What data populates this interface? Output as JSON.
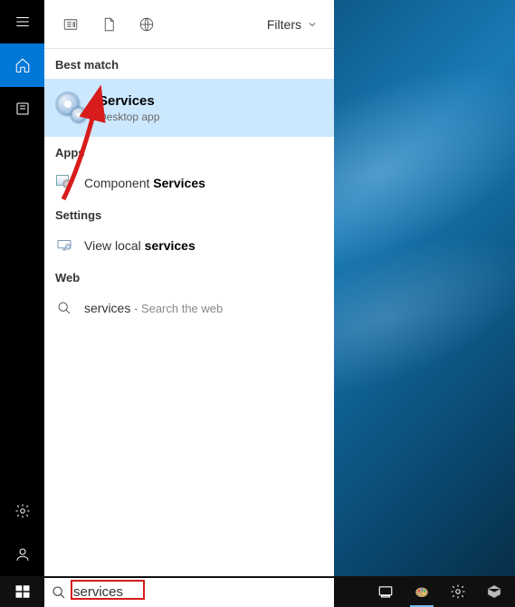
{
  "panel": {
    "filters_label": "Filters",
    "sections": {
      "best_match": "Best match",
      "apps": "Apps",
      "settings": "Settings",
      "web": "Web"
    },
    "best": {
      "title": "Services",
      "subtitle": "Desktop app"
    },
    "apps": {
      "component_prefix": "Component ",
      "component_bold": "Services"
    },
    "settings": {
      "view_local_prefix": "View local ",
      "view_local_bold": "services"
    },
    "web": {
      "term": "services",
      "suffix": " - Search the web"
    }
  },
  "taskbar": {
    "search_value": "services"
  },
  "colors": {
    "accent": "#0078d7",
    "highlight": "#cce8ff",
    "annotation": "#d81b1b"
  }
}
